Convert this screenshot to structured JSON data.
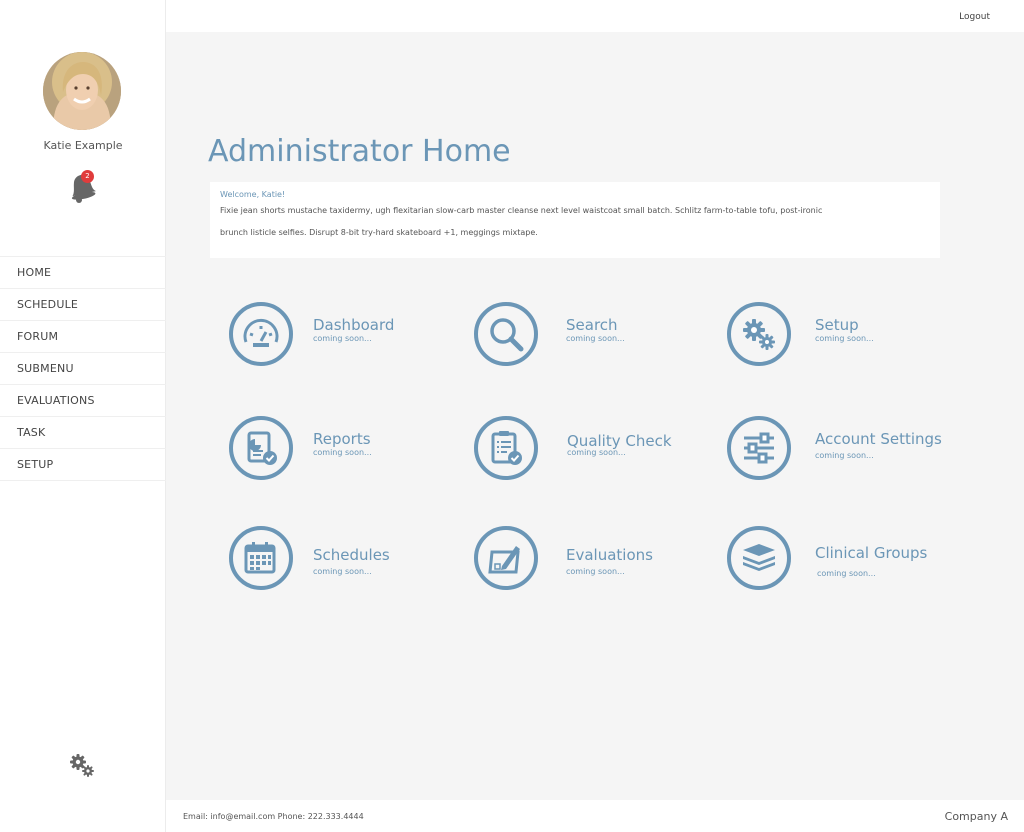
{
  "topbar": {
    "logout_label": "Logout"
  },
  "user": {
    "name": "Katie Example",
    "notification_count": "2"
  },
  "nav": {
    "items": [
      {
        "label": "HOME"
      },
      {
        "label": "SCHEDULE"
      },
      {
        "label": "FORUM"
      },
      {
        "label": "SUBMENU"
      },
      {
        "label": "EVALUATIONS"
      },
      {
        "label": "TASK"
      },
      {
        "label": "SETUP"
      }
    ]
  },
  "main": {
    "title": "Administrator Home",
    "welcome": "Welcome, Katie!",
    "intro_line1": "Fixie jean shorts mustache taxidermy, ugh flexitarian slow-carb master cleanse next level waistcoat small batch. Schlitz farm-to-table tofu, post-ironic",
    "intro_line2": "brunch listicle selfies. Disrupt 8-bit try-hard skateboard +1, meggings mixtape.",
    "tiles": [
      {
        "title": "Dashboard",
        "subtitle": "coming soon...",
        "icon": "speedometer-icon"
      },
      {
        "title": "Search",
        "subtitle": "coming soon...",
        "icon": "magnifier-icon"
      },
      {
        "title": "Setup",
        "subtitle": "coming soon...",
        "icon": "gears-icon"
      },
      {
        "title": "Reports",
        "subtitle": "coming soon...",
        "icon": "report-icon"
      },
      {
        "title": "Quality Check",
        "subtitle": "coming soon...",
        "icon": "clipboard-check-icon"
      },
      {
        "title": "Account Settings",
        "subtitle": "coming soon...",
        "icon": "sliders-icon"
      },
      {
        "title": "Schedules",
        "subtitle": "coming soon...",
        "icon": "calendar-icon"
      },
      {
        "title": "Evaluations",
        "subtitle": "coming soon...",
        "icon": "pen-paper-icon"
      },
      {
        "title": "Clinical Groups",
        "subtitle": "coming soon...",
        "icon": "layers-icon"
      }
    ]
  },
  "footer": {
    "contact": "Email: info@email.com  Phone: 222.333.4444",
    "company": "Company A"
  },
  "colors": {
    "accent": "#6b96b6",
    "badge": "#e03c3c",
    "background": "#f5f5f5"
  }
}
